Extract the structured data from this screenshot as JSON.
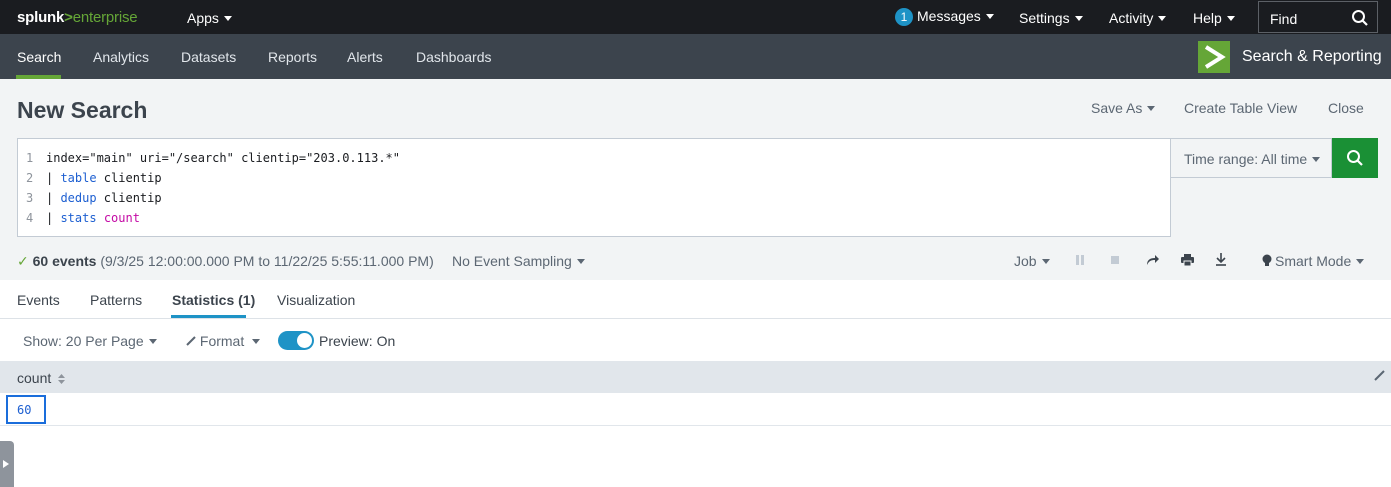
{
  "topbar": {
    "logo_splunk": "splunk",
    "logo_gt": ">",
    "logo_enterprise": "enterprise",
    "apps": "Apps",
    "messages_count": "1",
    "messages": "Messages",
    "settings": "Settings",
    "activity": "Activity",
    "help": "Help",
    "find_placeholder": "Find"
  },
  "appbar": {
    "tabs": [
      "Search",
      "Analytics",
      "Datasets",
      "Reports",
      "Alerts",
      "Dashboards"
    ],
    "active_tab": "Search",
    "app_name": "Search & Reporting"
  },
  "page": {
    "title": "New Search",
    "save_as": "Save As",
    "create_table_view": "Create Table View",
    "close": "Close"
  },
  "query": {
    "lines": [
      {
        "num": "1",
        "pipe": "",
        "keyword": "",
        "rest": "index=\"main\" uri=\"/search\" clientip=\"203.0.113.*\"",
        "fn": ""
      },
      {
        "num": "2",
        "pipe": "| ",
        "keyword": "table",
        "rest": " clientip",
        "fn": ""
      },
      {
        "num": "3",
        "pipe": "| ",
        "keyword": "dedup",
        "rest": " clientip",
        "fn": ""
      },
      {
        "num": "4",
        "pipe": "| ",
        "keyword": "stats",
        "rest": " ",
        "fn": "count"
      }
    ],
    "time_range": "Time range: All time"
  },
  "status": {
    "events": "60 events",
    "range": "(9/3/25 12:00:00.000 PM to 11/22/25 5:55:11.000 PM)",
    "sampling": "No Event Sampling",
    "job": "Job",
    "mode": "Smart Mode"
  },
  "result_tabs": {
    "events": "Events",
    "patterns": "Patterns",
    "statistics": "Statistics (1)",
    "visualization": "Visualization"
  },
  "toolbar": {
    "show": "Show: 20 Per Page",
    "format": "Format",
    "preview": "Preview: On"
  },
  "table": {
    "columns": [
      "count"
    ],
    "rows": [
      [
        "60"
      ]
    ]
  },
  "colors": {
    "topbar": "#1a1c20",
    "appbar": "#3c444d",
    "accent_green": "#65a637",
    "search_button": "#1a9035",
    "link_blue": "#1e93c6"
  }
}
